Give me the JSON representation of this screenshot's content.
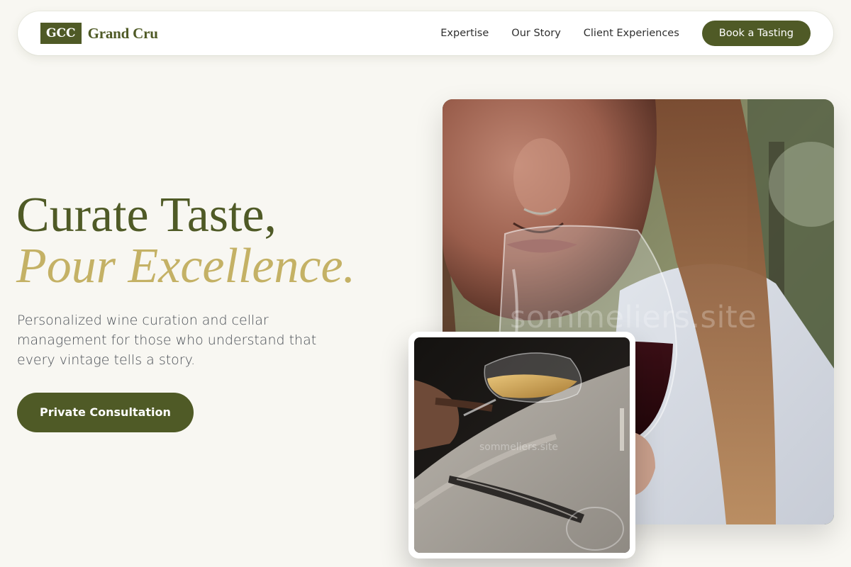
{
  "nav": {
    "logo_mark": "GCC",
    "logo_text": "Grand Cru",
    "links": [
      "Expertise",
      "Our Story",
      "Client Experiences"
    ],
    "cta": "Book a Tasting"
  },
  "hero": {
    "headline_line1": "Curate Taste,",
    "headline_line2": "Pour Excellence.",
    "subcopy": "Personalized wine curation and cellar management for those who understand that every vintage tells a story.",
    "cta": "Private Consultation"
  },
  "images": {
    "main_watermark": "sommeliers.site",
    "small_watermark": "sommeliers.site"
  },
  "colors": {
    "brand_olive": "#4f5a26",
    "accent_gold": "#c4b165",
    "background": "#f8f7f2"
  }
}
